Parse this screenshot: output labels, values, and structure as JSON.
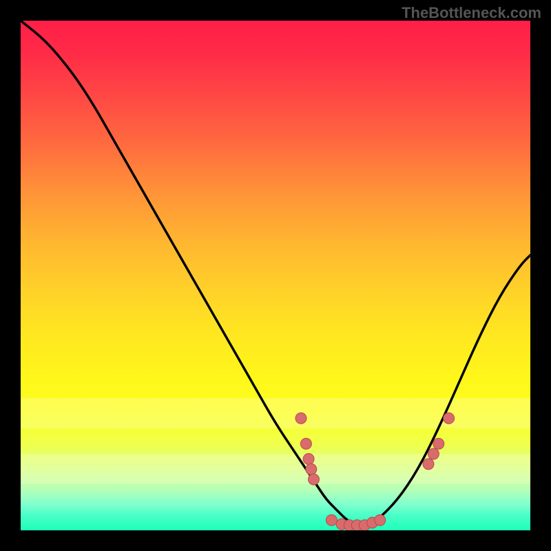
{
  "attribution": "TheBottleneck.com",
  "colors": {
    "curve": "#000000",
    "dot_fill": "#d86b6b",
    "dot_stroke": "#b84a4a"
  },
  "chart_data": {
    "type": "line",
    "title": "",
    "xlabel": "",
    "ylabel": "",
    "xlim": [
      0,
      100
    ],
    "ylim": [
      0,
      100
    ],
    "series": [
      {
        "name": "bottleneck-curve",
        "x": [
          0,
          5,
          10,
          14,
          18,
          22,
          26,
          30,
          34,
          38,
          42,
          46,
          50,
          54,
          58,
          60,
          62,
          64,
          66,
          68,
          70,
          74,
          78,
          82,
          86,
          90,
          94,
          98,
          100
        ],
        "values": [
          100,
          96,
          90,
          84,
          77,
          70,
          63,
          56,
          49,
          42,
          35,
          28,
          21,
          15,
          9,
          6,
          4,
          2,
          1,
          1,
          2,
          6,
          12,
          20,
          29,
          38,
          46,
          52,
          54
        ]
      }
    ],
    "markers": [
      {
        "x": 55,
        "y": 22
      },
      {
        "x": 56,
        "y": 17
      },
      {
        "x": 56.5,
        "y": 14
      },
      {
        "x": 57,
        "y": 12
      },
      {
        "x": 57.5,
        "y": 10
      },
      {
        "x": 61,
        "y": 2
      },
      {
        "x": 63,
        "y": 1.2
      },
      {
        "x": 64.5,
        "y": 1
      },
      {
        "x": 66,
        "y": 1
      },
      {
        "x": 67.5,
        "y": 1
      },
      {
        "x": 69,
        "y": 1.5
      },
      {
        "x": 70.5,
        "y": 2
      },
      {
        "x": 80,
        "y": 13
      },
      {
        "x": 81,
        "y": 15
      },
      {
        "x": 82,
        "y": 17
      },
      {
        "x": 84,
        "y": 22
      }
    ],
    "light_bands": [
      {
        "y_center": 23,
        "height": 6
      },
      {
        "y_center": 12,
        "height": 6
      }
    ]
  }
}
